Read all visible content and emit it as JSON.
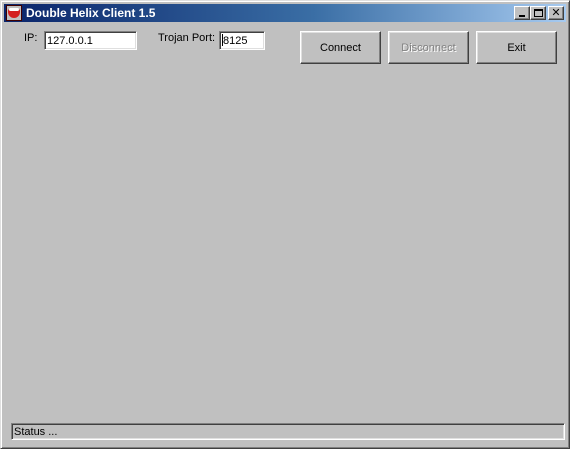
{
  "window": {
    "title": "Double Helix Client 1.5",
    "icon": "app-bowl-icon"
  },
  "title_controls": {
    "minimize_icon": "minimize-icon",
    "maximize_icon": "maximize-icon",
    "close_icon": "close-icon",
    "close_glyph": "✕"
  },
  "connection": {
    "ip_label": "IP:",
    "ip_value": "127.0.0.1",
    "port_label": "Trojan Port:",
    "port_value": "8125"
  },
  "buttons": {
    "connect": "Connect",
    "disconnect": "Disconnect",
    "exit": "Exit"
  },
  "status": {
    "text": "Status ..."
  },
  "colors": {
    "titlebar_start": "#0a246a",
    "titlebar_end": "#a6caf0",
    "face": "#c0c0c0"
  }
}
